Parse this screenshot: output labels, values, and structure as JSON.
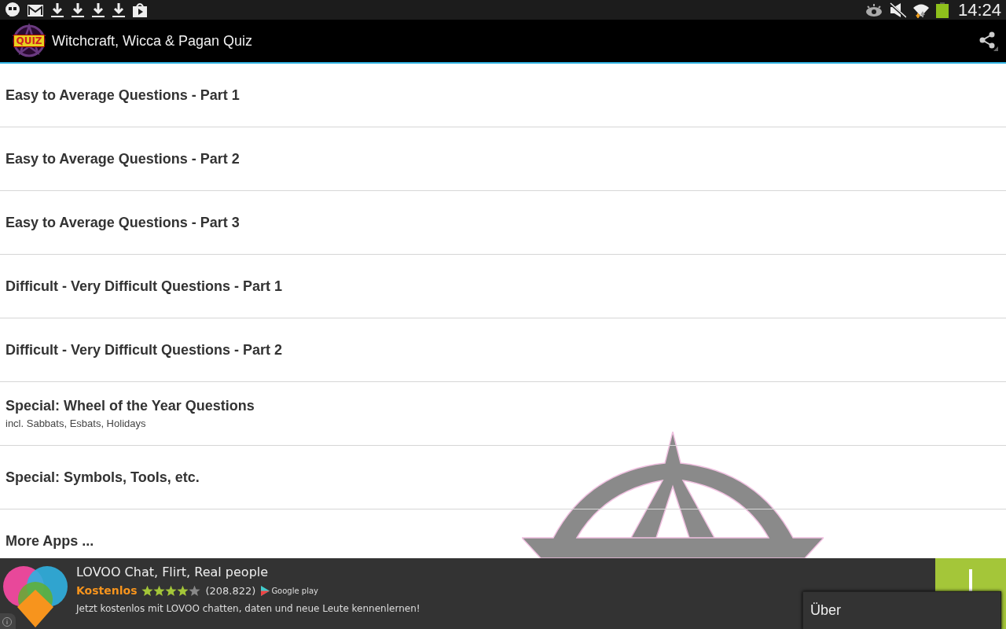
{
  "status_bar": {
    "time": "14:24"
  },
  "app_bar": {
    "logo_text": "QUIZ",
    "title": "Witchcraft, Wicca & Pagan Quiz"
  },
  "menu_items": [
    {
      "title": "Easy to Average Questions - Part 1"
    },
    {
      "title": "Easy to Average Questions - Part 2"
    },
    {
      "title": "Easy to Average Questions - Part 3"
    },
    {
      "title": "Difficult - Very Difficult Questions - Part 1"
    },
    {
      "title": "Difficult - Very Difficult Questions - Part 2"
    },
    {
      "title": "Special: Wheel of the Year Questions",
      "subtitle": "incl. Sabbats, Esbats, Holidays"
    },
    {
      "title": "Special: Symbols, Tools, etc."
    },
    {
      "title": "More Apps ..."
    }
  ],
  "ad": {
    "title": "LOVOO Chat, Flirt, Real people",
    "price": "Kostenlos",
    "stars": 4,
    "rating_count": "(208.822)",
    "store": "Google play",
    "description": "Jetzt kostenlos mit LOVOO chatten, daten und neue Leute kennenlernen!"
  },
  "popup_menu": [
    {
      "label": "Über"
    }
  ]
}
